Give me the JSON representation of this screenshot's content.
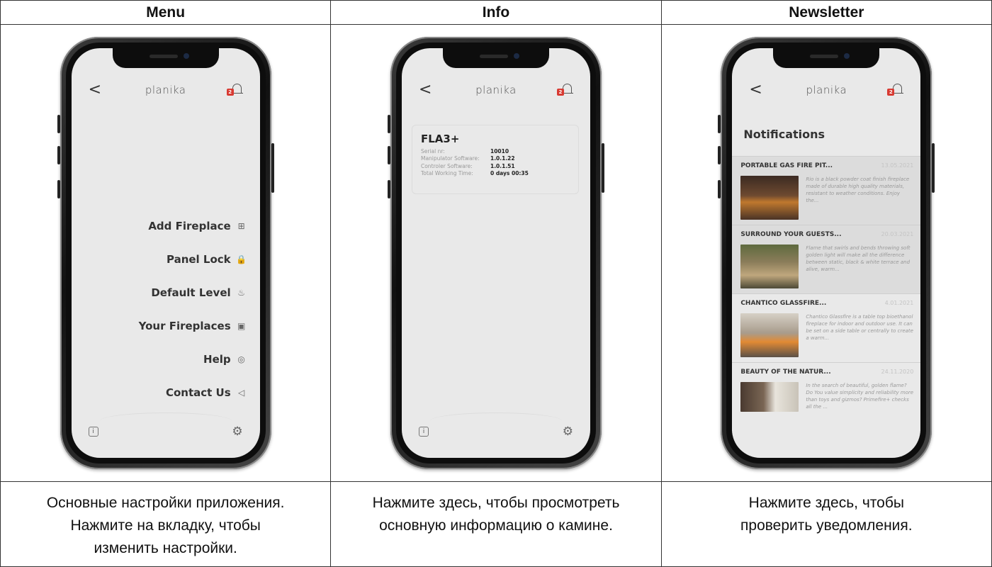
{
  "columns": [
    {
      "header": "Menu",
      "caption_lines": [
        "Основные настройки приложения.",
        "Нажмите на вкладку, чтобы",
        "изменить настройки."
      ]
    },
    {
      "header": "Info",
      "caption_lines": [
        "Нажмите здесь, чтобы просмотреть",
        "основную информацию о камине."
      ]
    },
    {
      "header": "Newsletter",
      "caption_lines": [
        "Нажмите здесь, чтобы",
        "проверить уведомления."
      ]
    }
  ],
  "app": {
    "brand": "planika",
    "back_icon": "chevron-left-icon",
    "back_glyph": "<",
    "notification_badge": "2"
  },
  "menu": {
    "items": [
      {
        "label": "Add Fireplace",
        "icon": "plus-square-icon",
        "glyph": "⊞"
      },
      {
        "label": "Panel Lock",
        "icon": "lock-icon",
        "glyph": "🔒"
      },
      {
        "label": "Default Level",
        "icon": "flame-icon",
        "glyph": "♨"
      },
      {
        "label": "Your Fireplaces",
        "icon": "fireplace-icon",
        "glyph": "▣"
      },
      {
        "label": "Help",
        "icon": "lifebuoy-icon",
        "glyph": "◎"
      },
      {
        "label": "Contact Us",
        "icon": "send-icon",
        "glyph": "◁"
      }
    ],
    "info_glyph": "i",
    "settings_glyph": "⚙"
  },
  "info": {
    "model": "FLA3+",
    "rows": [
      {
        "key": "Serial nr:",
        "value": "10010"
      },
      {
        "key": "Manipulator Software:",
        "value": "1.0.1.22"
      },
      {
        "key": "Controler Software:",
        "value": "1.0.1.51"
      },
      {
        "key": "Total Working Time:",
        "value": "0 days 00:35"
      }
    ]
  },
  "newsletter": {
    "title": "Notifications",
    "items": [
      {
        "title": "PORTABLE GAS FIRE PIT...",
        "date": "13.05.2021",
        "text": "Rio is a black powder coat finish fireplace made of durable high quality materials, resistant to weather conditions. Enjoy the..."
      },
      {
        "title": "SURROUND YOUR GUESTS...",
        "date": "20.03.2021",
        "text": "Flame that swirls and bends throwing soft golden light will make all the difference between static, black & white terrace and alive, warm..."
      },
      {
        "title": "CHANTICO GLASSFIRE...",
        "date": "4.01.2021",
        "text": "Chantico Glassfire is a table top bioethanol fireplace for indoor and outdoor use. It can be set on a side table or centrally to create a warm..."
      },
      {
        "title": "BEAUTY OF THE NATUR...",
        "date": "24.11.2020",
        "text": "In the search of beautiful, golden flame? Do You value simplicity and reliability more than toys and gizmos? Primefire+ checks all the ..."
      }
    ]
  }
}
